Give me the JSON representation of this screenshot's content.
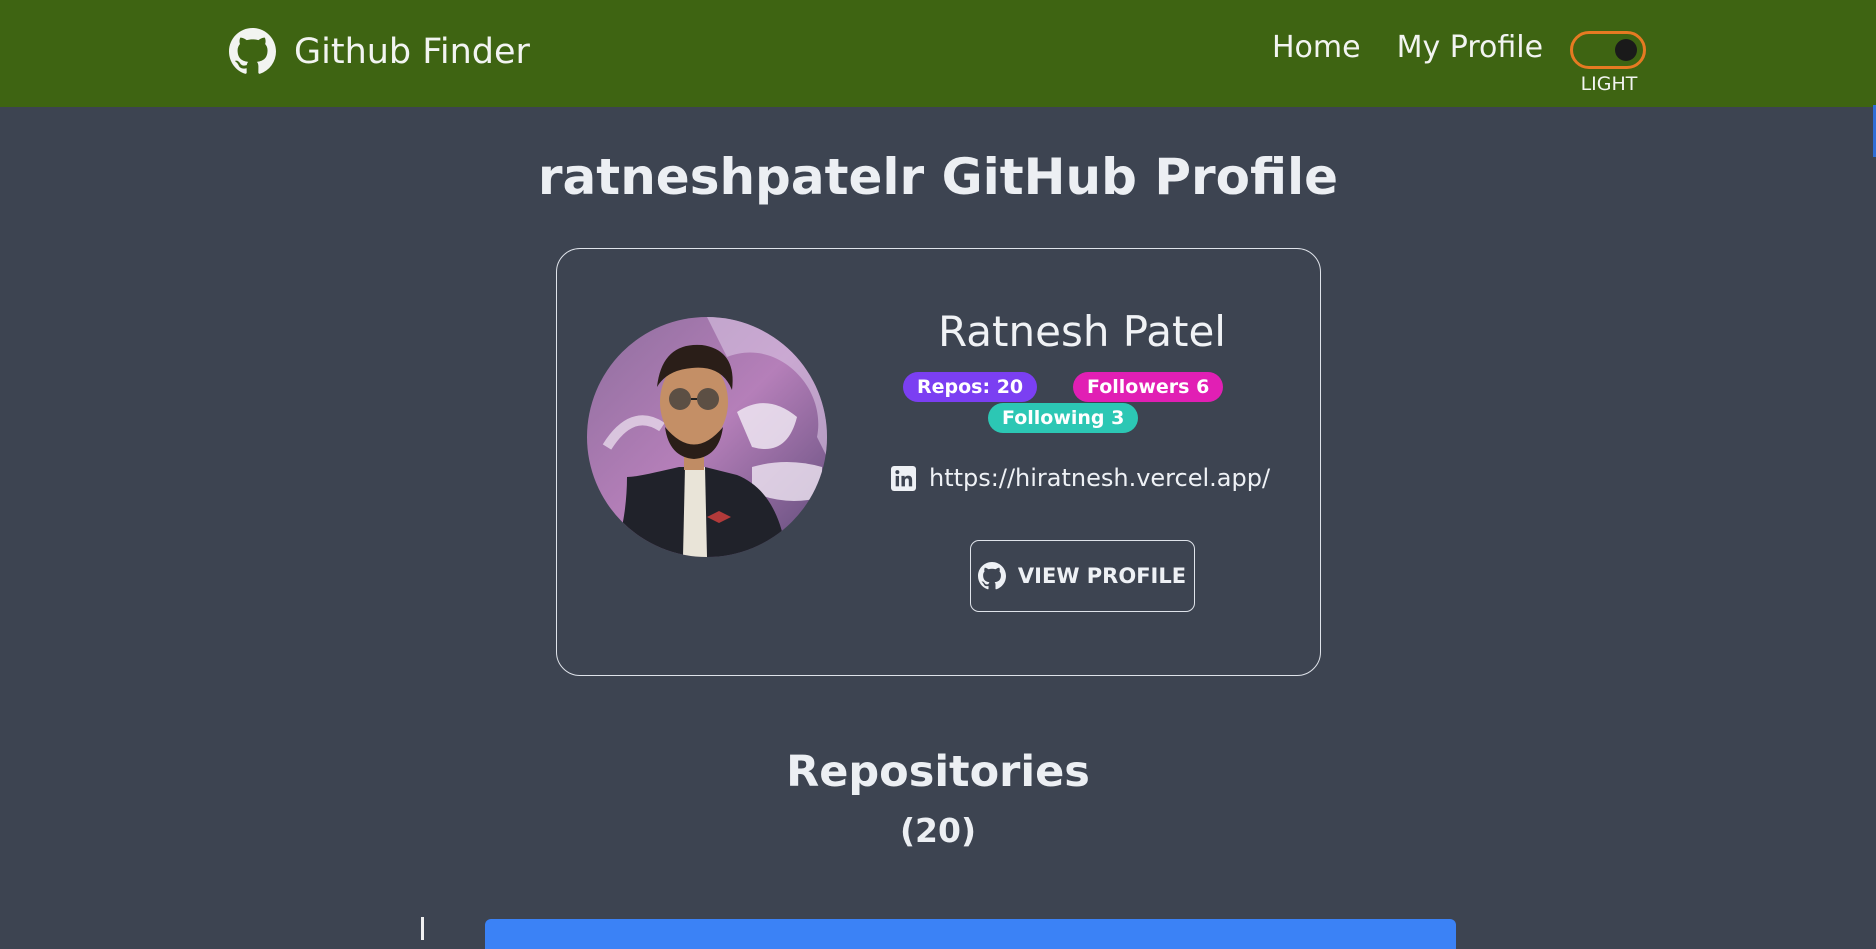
{
  "navbar": {
    "brand": "Github Finder",
    "links": [
      {
        "label": "Home"
      },
      {
        "label": "My Profile"
      }
    ],
    "theme_toggle_label": "LIGHT"
  },
  "page": {
    "title": "ratneshpatelr GitHub Profile"
  },
  "profile": {
    "name": "Ratnesh Patel",
    "badges": {
      "repos": "Repos: 20",
      "followers": "Followers 6",
      "following": "Following 3"
    },
    "website": "https://hiratnesh.vercel.app/",
    "view_button": "VIEW PROFILE"
  },
  "repositories": {
    "title": "Repositories",
    "count": "(20)"
  },
  "icons": {
    "brand": "github-icon",
    "link": "linkedin-icon",
    "button": "github-icon"
  },
  "colors": {
    "navbar_bg": "#3e6412",
    "page_bg": "#3d4451",
    "toggle_border": "#e67a22",
    "badge_repos": "#7b3ff2",
    "badge_followers": "#e11fb4",
    "badge_following": "#2cc7b4",
    "repo_bar": "#3b82f6"
  }
}
